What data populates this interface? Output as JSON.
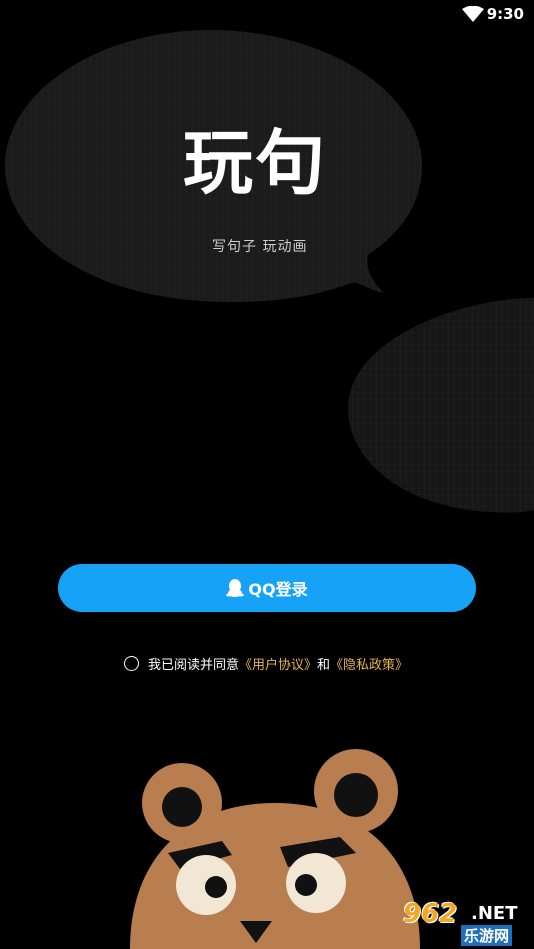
{
  "status_bar": {
    "time": "9:30",
    "wifi_icon": "wifi-icon"
  },
  "brand": {
    "logo_text": "玩句",
    "tagline": "写句子 玩动画"
  },
  "login": {
    "qq_button_label": "QQ登录",
    "qq_icon": "qq-penguin-icon",
    "color": "#16a3f7"
  },
  "agreement": {
    "prefix": "我已阅读并同意",
    "user_agreement": "《用户协议》",
    "and": "和",
    "privacy_policy": "《隐私政策》",
    "link_color": "#e8b24a"
  },
  "watermark": {
    "main": "962",
    "net": ".NET",
    "sub": "乐游网"
  }
}
